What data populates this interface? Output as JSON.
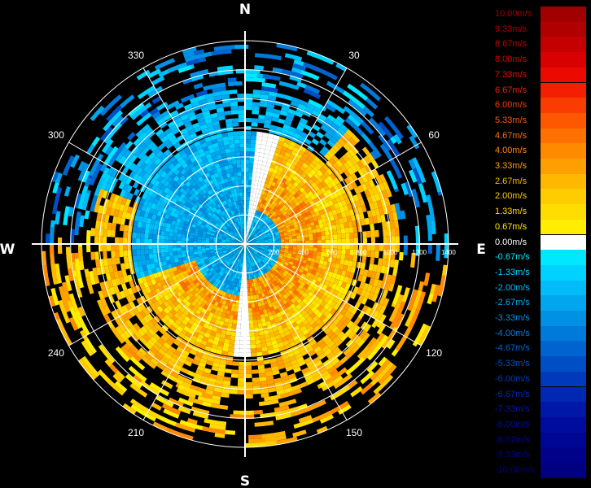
{
  "radar": {
    "compass": {
      "north": "N",
      "south": "S",
      "east": "E",
      "west": "W"
    },
    "azimuth_labels": [
      "30",
      "60",
      "120",
      "150",
      "210",
      "240",
      "300",
      "330"
    ],
    "range_labels": [
      "200",
      "400",
      "600",
      "800",
      "1000",
      "1200",
      "1400"
    ],
    "colors": {
      "background": "#000000",
      "grid": "#ffffff",
      "axes": "#ffffff"
    }
  },
  "legend": {
    "entries": [
      {
        "label": "10.00m/s",
        "color": "#a00000"
      },
      {
        "label": "9.33m/s",
        "color": "#b00000"
      },
      {
        "label": "8.67m/s",
        "color": "#c40000"
      },
      {
        "label": "8.00m/s",
        "color": "#d80000"
      },
      {
        "label": "7.33m/s",
        "color": "#ea0a00"
      },
      {
        "label": "6.67m/s",
        "color": "#f41e00"
      },
      {
        "label": "6.00m/s",
        "color": "#fa3c00"
      },
      {
        "label": "5.33m/s",
        "color": "#fd5800"
      },
      {
        "label": "4.67m/s",
        "color": "#ff7000"
      },
      {
        "label": "4.00m/s",
        "color": "#ff8a00"
      },
      {
        "label": "3.33m/s",
        "color": "#ffa000"
      },
      {
        "label": "2.67m/s",
        "color": "#ffb800"
      },
      {
        "label": "2.00m/s",
        "color": "#ffcc00"
      },
      {
        "label": "1.33m/s",
        "color": "#ffdd00"
      },
      {
        "label": "0.67m/s",
        "color": "#ffee00"
      },
      {
        "label": "0.00m/s",
        "color": "#ffffff"
      },
      {
        "label": "-0.67m/s",
        "color": "#00e8ff"
      },
      {
        "label": "-1.33m/s",
        "color": "#00d2ff"
      },
      {
        "label": "-2.00m/s",
        "color": "#00bcf8"
      },
      {
        "label": "-2.67m/s",
        "color": "#00a6ee"
      },
      {
        "label": "-3.33m/s",
        "color": "#0090e4"
      },
      {
        "label": "-4.00m/s",
        "color": "#007ada"
      },
      {
        "label": "-4.67m/s",
        "color": "#0064d0"
      },
      {
        "label": "-5.33m/s",
        "color": "#004ec6"
      },
      {
        "label": "-6.00m/s",
        "color": "#003abc"
      },
      {
        "label": "-6.67m/s",
        "color": "#0028b2"
      },
      {
        "label": "-7.33m/s",
        "color": "#0018a8"
      },
      {
        "label": "-8.00m/s",
        "color": "#000c9e"
      },
      {
        "label": "-8.67m/s",
        "color": "#000694"
      },
      {
        "label": "-9.33m/s",
        "color": "#00038a"
      },
      {
        "label": "-10.00m/s",
        "color": "#000080"
      }
    ]
  }
}
